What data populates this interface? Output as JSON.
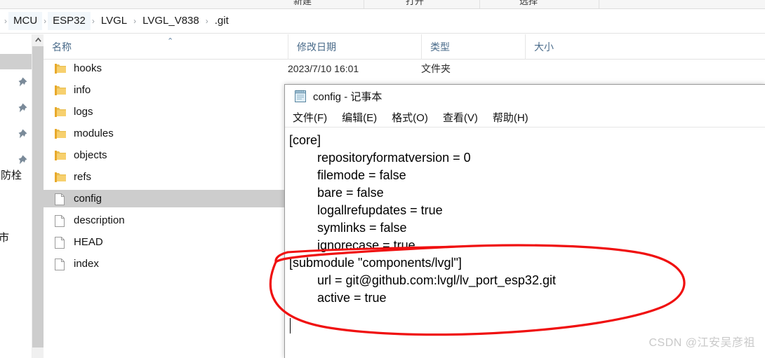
{
  "ribbon": {
    "items": [
      "新建",
      "打开",
      "选择"
    ]
  },
  "breadcrumb": {
    "root_chevron": "›",
    "separator": "›",
    "items": [
      "MCU",
      "ESP32",
      "LVGL",
      "LVGL_V838",
      ".git"
    ]
  },
  "nav_pane": {
    "scroll_up_icon": "chevron-up-icon",
    "pin_icon": "pin-icon",
    "pins": 4,
    "clipped_labels": [
      "消防栓",
      "市"
    ]
  },
  "file_list": {
    "columns": [
      {
        "label": "名称",
        "sorted": true,
        "sort_mark": "⌃"
      },
      {
        "label": "修改日期"
      },
      {
        "label": "类型"
      },
      {
        "label": "大小"
      }
    ],
    "first_row_meta": {
      "date": "2023/7/10 16:01",
      "type": "文件夹"
    },
    "rows": [
      {
        "name": "hooks",
        "icon": "folder-icon",
        "selected": false
      },
      {
        "name": "info",
        "icon": "folder-icon",
        "selected": false
      },
      {
        "name": "logs",
        "icon": "folder-icon",
        "selected": false
      },
      {
        "name": "modules",
        "icon": "folder-icon",
        "selected": false
      },
      {
        "name": "objects",
        "icon": "folder-icon",
        "selected": false
      },
      {
        "name": "refs",
        "icon": "folder-icon",
        "selected": false
      },
      {
        "name": "config",
        "icon": "file-icon",
        "selected": true
      },
      {
        "name": "description",
        "icon": "file-icon",
        "selected": false
      },
      {
        "name": "HEAD",
        "icon": "file-icon",
        "selected": false
      },
      {
        "name": "index",
        "icon": "file-icon",
        "selected": false
      }
    ]
  },
  "notepad": {
    "icon": "notepad-icon",
    "title": "config - 记事本",
    "menu": [
      "文件(F)",
      "编辑(E)",
      "格式(O)",
      "查看(V)",
      "帮助(H)"
    ],
    "content": "[core]\n\trepositoryformatversion = 0\n\tfilemode = false\n\tbare = false\n\tlogallrefupdates = true\n\tsymlinks = false\n\tignorecase = true\n[submodule \"components/lvgl\"]\n\turl = git@github.com:lvgl/lv_port_esp32.git\n\tactive = true\n"
  },
  "annotation": {
    "shape": "hand-drawn-ellipse",
    "color": "#f01010",
    "encircles": "[submodule \"components/lvgl\"] block"
  },
  "watermark": {
    "text": "CSDN @江安吴彦祖",
    "color": "#c9c9c9"
  }
}
